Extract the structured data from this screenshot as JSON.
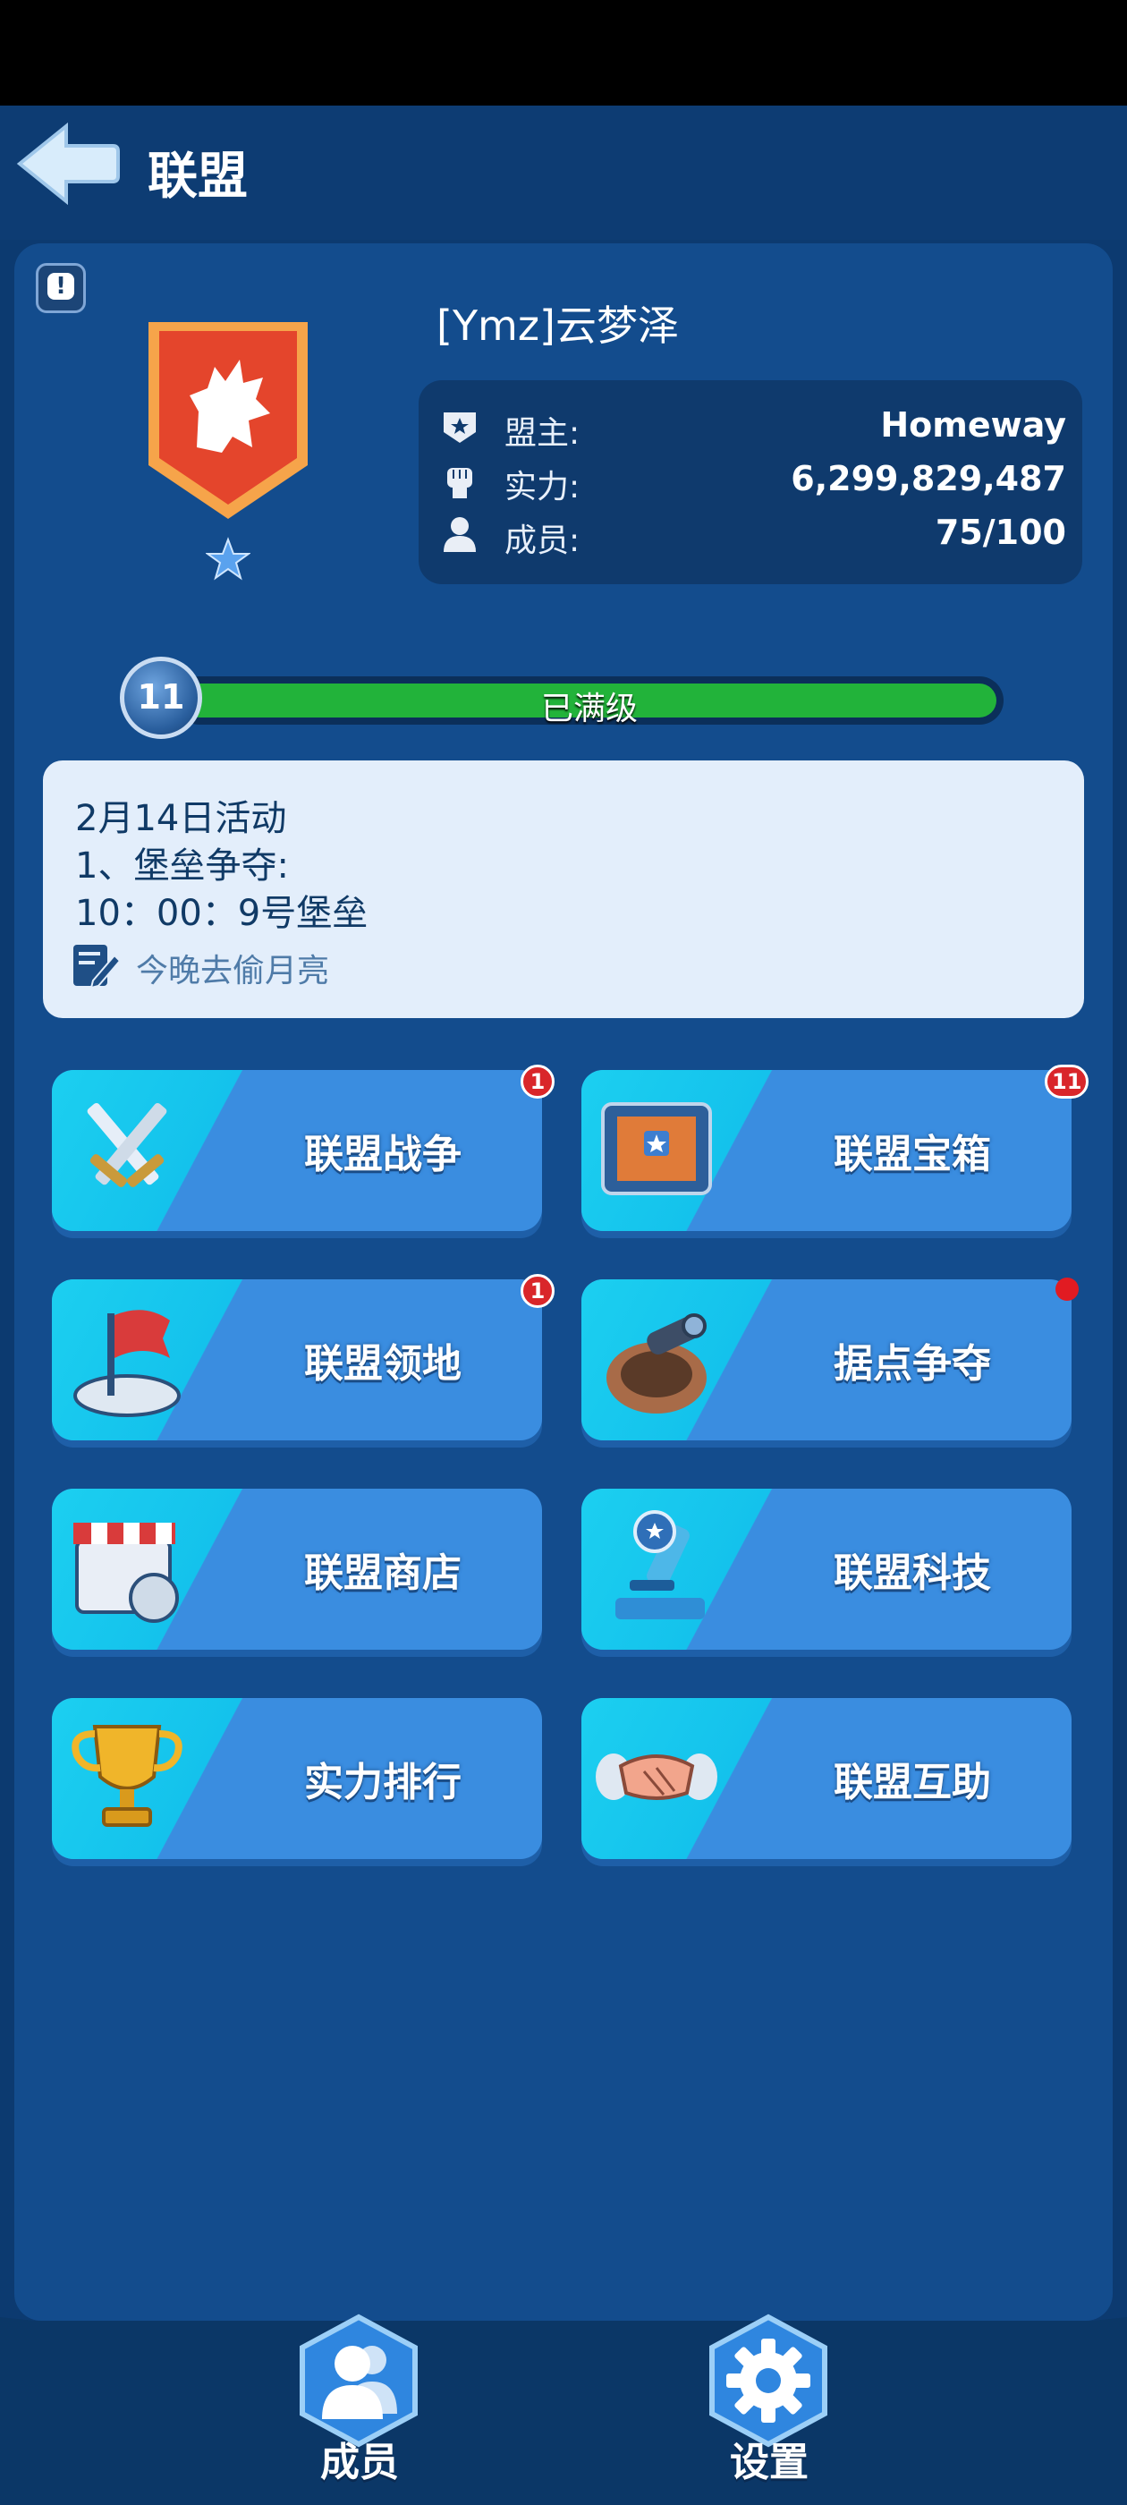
{
  "header": {
    "title": "联盟"
  },
  "alliance": {
    "name": "[Ymz]云梦泽",
    "leader_label": "盟主:",
    "leader_value": "Homeway",
    "power_label": "实力:",
    "power_value": "6,299,829,487",
    "members_label": "成员:",
    "members_value": "75/100",
    "level": "11",
    "level_status": "已满级",
    "level_progress": 1.0
  },
  "notice": {
    "line1": "2月14日活动",
    "line2": "1、堡垒争夺:",
    "line3": "10：00：9号堡垒",
    "memo": "今晚去偷月亮"
  },
  "tiles": [
    {
      "label": "联盟战争",
      "badge": "1",
      "icon": "crossed-swords-icon"
    },
    {
      "label": "联盟宝箱",
      "badge": "11",
      "icon": "treasure-chest-icon"
    },
    {
      "label": "联盟领地",
      "badge": "1",
      "icon": "flag-icon"
    },
    {
      "label": "据点争夺",
      "badge": "",
      "icon": "cannon-icon"
    },
    {
      "label": "联盟商店",
      "badge": "",
      "icon": "shop-icon"
    },
    {
      "label": "联盟科技",
      "badge": "",
      "icon": "microscope-icon"
    },
    {
      "label": "实力排行",
      "badge": "",
      "icon": "trophy-icon"
    },
    {
      "label": "联盟互助",
      "badge": "",
      "icon": "handshake-icon"
    }
  ],
  "bottom_nav": {
    "members": "成员",
    "settings": "设置"
  },
  "colors": {
    "accent": "#22b33a",
    "panel": "#134c8d",
    "tile": "#3a8de0",
    "badge": "#d9262a"
  }
}
